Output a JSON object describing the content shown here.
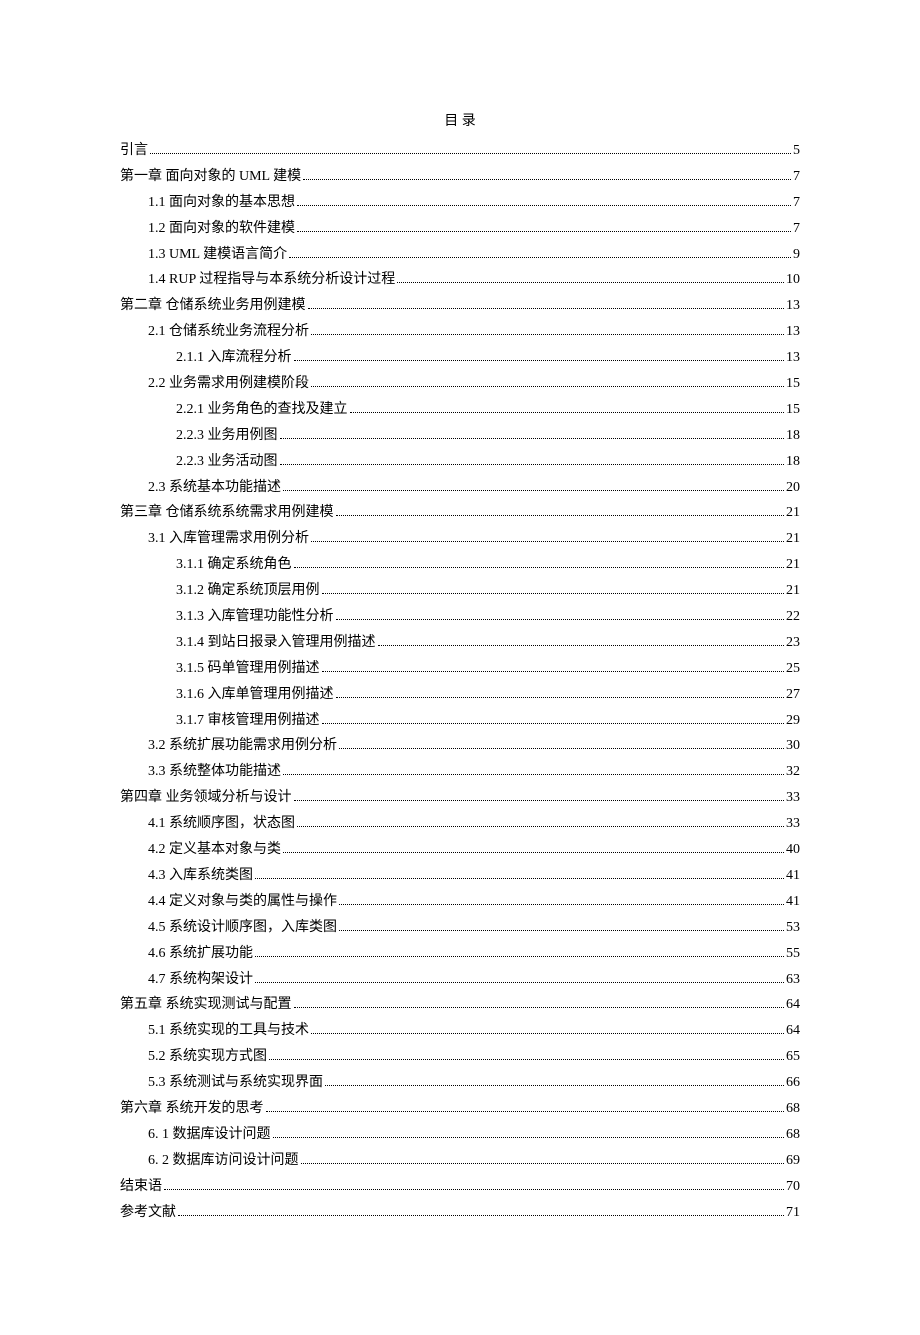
{
  "title": "目 录",
  "entries": [
    {
      "level": 0,
      "text": "引言",
      "page": "5"
    },
    {
      "level": 0,
      "text": "第一章  面向对象的 UML 建模",
      "page": "7"
    },
    {
      "level": 1,
      "text": "1.1 面向对象的基本思想",
      "page": "7"
    },
    {
      "level": 1,
      "text": "1.2 面向对象的软件建模",
      "page": "7"
    },
    {
      "level": 1,
      "text": "1.3 UML 建模语言简介",
      "page": "9"
    },
    {
      "level": 1,
      "text": "1.4 RUP 过程指导与本系统分析设计过程",
      "page": "10"
    },
    {
      "level": 0,
      "text": "第二章  仓储系统业务用例建模",
      "page": "13"
    },
    {
      "level": 1,
      "text": "2.1  仓储系统业务流程分析",
      "page": "13"
    },
    {
      "level": 2,
      "text": "2.1.1  入库流程分析",
      "page": "13"
    },
    {
      "level": 1,
      "text": "2.2 业务需求用例建模阶段",
      "page": "15"
    },
    {
      "level": 2,
      "text": "2.2.1 业务角色的查找及建立",
      "page": "15"
    },
    {
      "level": 2,
      "text": "2.2.3 业务用例图",
      "page": "18"
    },
    {
      "level": 2,
      "text": "2.2.3 业务活动图",
      "page": "18"
    },
    {
      "level": 1,
      "text": "2.3  系统基本功能描述",
      "page": "20"
    },
    {
      "level": 0,
      "text": "第三章  仓储系统系统需求用例建模",
      "page": "21"
    },
    {
      "level": 1,
      "text": "3.1  入库管理需求用例分析",
      "page": "21"
    },
    {
      "level": 2,
      "text": "3.1.1  确定系统角色",
      "page": "21"
    },
    {
      "level": 2,
      "text": "3.1.2  确定系统顶层用例",
      "page": "21"
    },
    {
      "level": 2,
      "text": "3.1.3  入库管理功能性分析",
      "page": "22"
    },
    {
      "level": 2,
      "text": "3.1.4  到站日报录入管理用例描述",
      "page": "23"
    },
    {
      "level": 2,
      "text": "3.1.5  码单管理用例描述",
      "page": "25"
    },
    {
      "level": 2,
      "text": "3.1.6  入库单管理用例描述",
      "page": "27"
    },
    {
      "level": 2,
      "text": "3.1.7  审核管理用例描述",
      "page": "29"
    },
    {
      "level": 1,
      "text": "3.2  系统扩展功能需求用例分析",
      "page": "30"
    },
    {
      "level": 1,
      "text": "3.3  系统整体功能描述",
      "page": "32"
    },
    {
      "level": 0,
      "text": "第四章  业务领域分析与设计",
      "page": "33"
    },
    {
      "level": 1,
      "text": "4.1  系统顺序图，状态图",
      "page": "33"
    },
    {
      "level": 1,
      "text": "4.2  定义基本对象与类",
      "page": "40"
    },
    {
      "level": 1,
      "text": "4.3  入库系统类图",
      "page": "41"
    },
    {
      "level": 1,
      "text": "4.4  定义对象与类的属性与操作",
      "page": "41"
    },
    {
      "level": 1,
      "text": "4.5  系统设计顺序图，入库类图",
      "page": "53"
    },
    {
      "level": 1,
      "text": "4.6  系统扩展功能",
      "page": "55"
    },
    {
      "level": 1,
      "text": "4.7  系统构架设计",
      "page": "63"
    },
    {
      "level": 0,
      "text": "第五章  系统实现测试与配置",
      "page": "64"
    },
    {
      "level": 1,
      "text": "5.1 系统实现的工具与技术",
      "page": "64"
    },
    {
      "level": 1,
      "text": "5.2  系统实现方式图",
      "page": "65"
    },
    {
      "level": 1,
      "text": "5.3  系统测试与系统实现界面",
      "page": "66"
    },
    {
      "level": 0,
      "text": "第六章  系统开发的思考",
      "page": "68"
    },
    {
      "level": 1,
      "text": "6. 1  数据库设计问题",
      "page": "68"
    },
    {
      "level": 1,
      "text": "6. 2  数据库访问设计问题",
      "page": "69"
    },
    {
      "level": 0,
      "text": "结束语",
      "page": "70"
    },
    {
      "level": 0,
      "text": "参考文献",
      "page": "71"
    }
  ]
}
